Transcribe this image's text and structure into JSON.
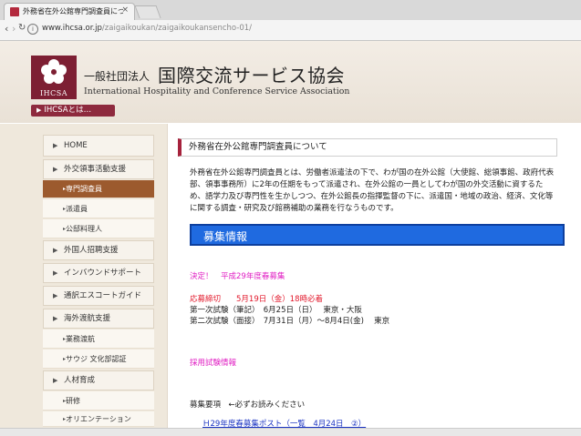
{
  "browser": {
    "tab_title": "外務省在外公館専門調査員につ",
    "tab_close": "×",
    "url_host": "www.ihcsa.or.jp",
    "url_path": "/zaigaikoukan/zaigaikoukansencho-01/",
    "back_glyph": "‹",
    "forward_glyph": "›",
    "reload_glyph": "↻"
  },
  "header": {
    "logo_text": "IHCSA",
    "org_prefix": "一般社団法人",
    "org_name": "国際交流サービス協会",
    "org_name_en": "International Hospitality and Conference Service Association",
    "about_button": "IHCSAとは…"
  },
  "sidebar": {
    "items": [
      {
        "label": "HOME"
      },
      {
        "label": "外交領事活動支援"
      },
      {
        "label": "専門調査員"
      },
      {
        "label": "派遣員"
      },
      {
        "label": "公邸料理人"
      },
      {
        "label": "外国人招聘支援"
      },
      {
        "label": "インバウンドサポート"
      },
      {
        "label": "通訳エスコートガイド"
      },
      {
        "label": "海外渡航支援"
      },
      {
        "label": "業務渡航"
      },
      {
        "label": "サウジ 文化部認証"
      },
      {
        "label": "人材育成"
      },
      {
        "label": "研修"
      },
      {
        "label": "オリエンテーション"
      }
    ]
  },
  "main": {
    "heading": "外務省在外公館専門調査員について",
    "intro": "外務省在外公館専門調査員とは、労働者派遣法の下で、わが国の在外公館（大使館、総領事館、政府代表部、領事事務所）に2年の任期をもって派遣され、在外公館の一員としてわが国の外交活動に資するため、語学力及び専門性を生かしつつ、在外公館長の指揮監督の下に、派遣国・地域の政治、経済、文化等に関する調査・研究及び館務補助の業務を行なうものです。",
    "recruit_title": "募集情報",
    "decided": "決定！　平成29年度春募集",
    "deadline": "応募締切　　5月19日（金）18時必着",
    "exam1": "第一次試験（筆記）　6月25日（日）　 東京・大阪",
    "exam2": "第二次試験（面接）　7月31日（月）～8月4日(金)　 東京",
    "hiring_info": "採用試験情報",
    "requirements": "募集要項　←必ずお読みください",
    "posts_link": "Ｈ29年度春募集ポスト（一覧　4月24日　②）"
  }
}
